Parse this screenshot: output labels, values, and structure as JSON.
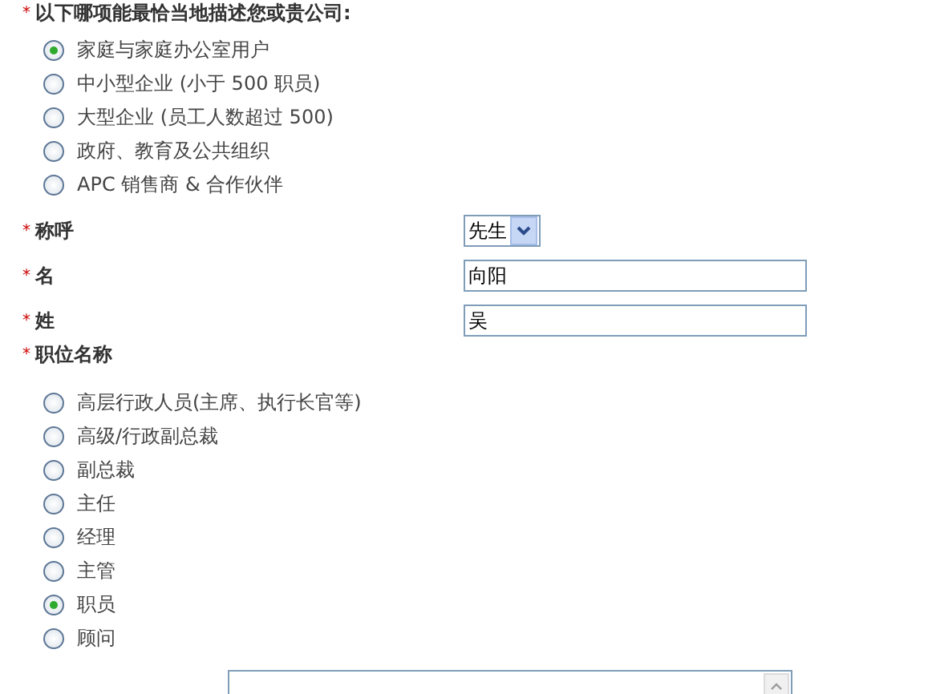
{
  "company_type": {
    "marker": "*",
    "label": "以下哪项能最恰当地描述您或贵公司:",
    "options": [
      {
        "label": "家庭与家庭办公室用户",
        "selected": true
      },
      {
        "label": "中小型企业 (小于 500 职员)",
        "selected": false
      },
      {
        "label": "大型企业 (员工人数超过 500)",
        "selected": false
      },
      {
        "label": "政府、教育及公共组织",
        "selected": false
      },
      {
        "label": "APC 销售商 & 合作伙伴",
        "selected": false
      }
    ]
  },
  "fields": [
    {
      "kind": "select",
      "marker": "*",
      "label": "称呼",
      "value": "先生"
    },
    {
      "kind": "text",
      "marker": "*",
      "label": "名",
      "value": "向阳"
    },
    {
      "kind": "text",
      "marker": "*",
      "label": "姓",
      "value": "吴"
    }
  ],
  "job_title": {
    "marker": "*",
    "label": "职位名称",
    "options": [
      {
        "label": "高层行政人员(主席、执行长官等)",
        "selected": false
      },
      {
        "label": "高级/行政副总裁",
        "selected": false
      },
      {
        "label": "副总裁",
        "selected": false
      },
      {
        "label": "主任",
        "selected": false
      },
      {
        "label": "经理",
        "selected": false
      },
      {
        "label": "主管",
        "selected": false
      },
      {
        "label": "职员",
        "selected": true
      },
      {
        "label": "顾问",
        "selected": false
      }
    ]
  }
}
